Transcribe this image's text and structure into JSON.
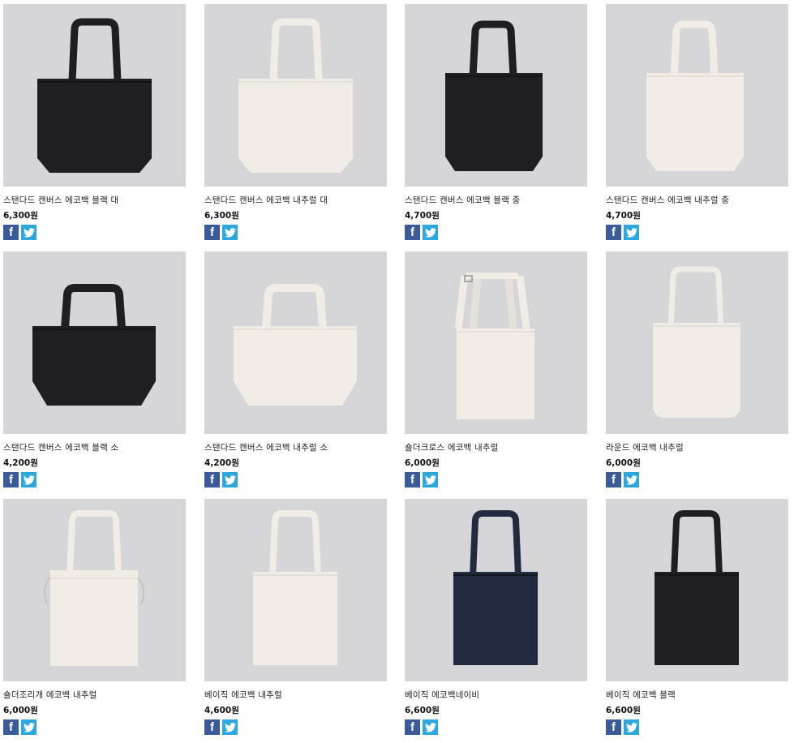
{
  "colors": {
    "photo_bg": "#d6d6d8",
    "black_bag": "#1f1f21",
    "natural_bag": "#f1ede6",
    "navy_bag": "#212a3e",
    "facebook": "#3b5a9a",
    "twitter": "#2ca7e0"
  },
  "social_icons": {
    "facebook": "facebook-icon",
    "twitter": "twitter-icon"
  },
  "products": [
    {
      "name": "스탠다드 캔버스 에코백 블랙 대",
      "price": "6,300원",
      "color": "black",
      "style": "wide-large"
    },
    {
      "name": "스탠다드 캔버스 에코백 내추럴 대",
      "price": "6,300원",
      "color": "natural",
      "style": "wide-large"
    },
    {
      "name": "스탠다드 캔버스 에코백 블랙 중",
      "price": "4,700원",
      "color": "black",
      "style": "medium"
    },
    {
      "name": "스탠다드 캔버스 에코백 내추럴 중",
      "price": "4,700원",
      "color": "natural",
      "style": "medium"
    },
    {
      "name": "스탠다드 캔버스 에코백 블랙 소",
      "price": "4,200원",
      "color": "black",
      "style": "small"
    },
    {
      "name": "스탠다드 캔버스 에코백 내추럴 소",
      "price": "4,200원",
      "color": "natural",
      "style": "small"
    },
    {
      "name": "숄더크로스 에코백 내추럴",
      "price": "6,000원",
      "color": "natural",
      "style": "cross"
    },
    {
      "name": "라운드 에코백 내추럴",
      "price": "6,000원",
      "color": "natural",
      "style": "round"
    },
    {
      "name": "숄더조리개 에코백 내추럴",
      "price": "6,000원",
      "color": "natural",
      "style": "drawstring"
    },
    {
      "name": "베이직 에코백 내추럴",
      "price": "4,600원",
      "color": "natural",
      "style": "basic"
    },
    {
      "name": "베이직 에코백네이비",
      "price": "6,600원",
      "color": "navy",
      "style": "basic"
    },
    {
      "name": "베이직 에코백 블랙",
      "price": "6,600원",
      "color": "black",
      "style": "basic"
    }
  ]
}
